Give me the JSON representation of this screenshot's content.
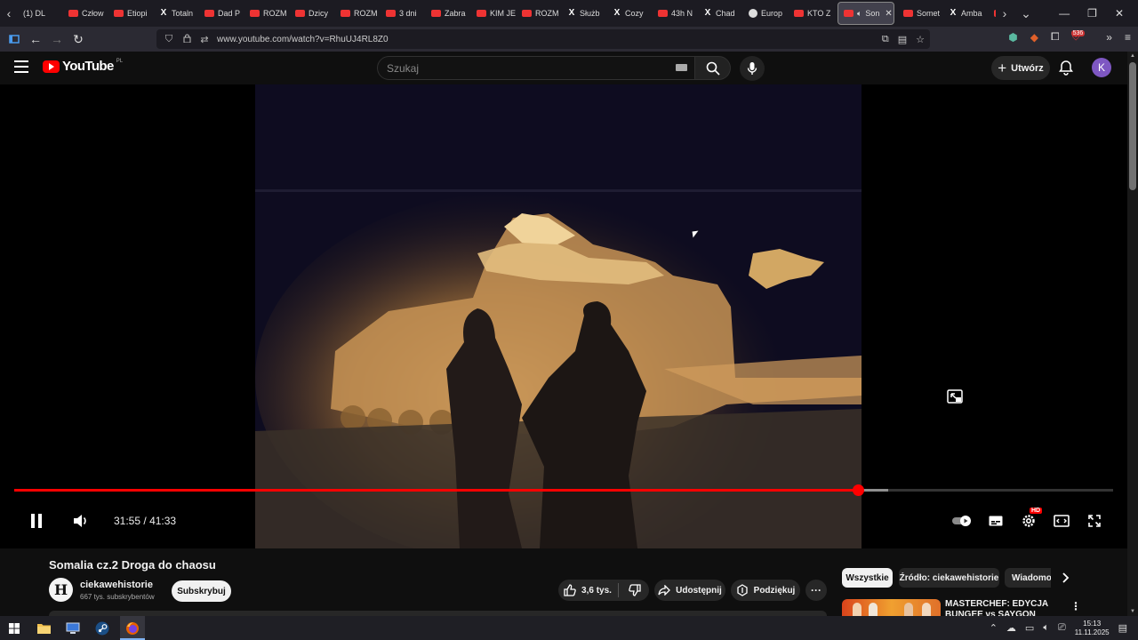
{
  "browser": {
    "tabs": [
      {
        "label": "(1) DL",
        "favicon": "none"
      },
      {
        "label": "Człow",
        "favicon": "youtube"
      },
      {
        "label": "Etiopi",
        "favicon": "youtube"
      },
      {
        "label": "Totaln",
        "favicon": "x"
      },
      {
        "label": "Dad P",
        "favicon": "youtube"
      },
      {
        "label": "ROZM",
        "favicon": "youtube"
      },
      {
        "label": "Dzicy",
        "favicon": "youtube"
      },
      {
        "label": "ROZM",
        "favicon": "youtube"
      },
      {
        "label": "3 dni",
        "favicon": "youtube"
      },
      {
        "label": "Zabra",
        "favicon": "youtube"
      },
      {
        "label": "KIM JE",
        "favicon": "youtube"
      },
      {
        "label": "ROZM",
        "favicon": "youtube"
      },
      {
        "label": "Służb",
        "favicon": "x"
      },
      {
        "label": "Cozy",
        "favicon": "x"
      },
      {
        "label": "43h N",
        "favicon": "youtube"
      },
      {
        "label": "Chad",
        "favicon": "x"
      },
      {
        "label": "Europ",
        "favicon": "globe"
      },
      {
        "label": "KTO Z",
        "favicon": "youtube"
      },
      {
        "label": "Son",
        "favicon": "youtube",
        "active": true,
        "audio": true
      },
      {
        "label": "Somet",
        "favicon": "youtube"
      },
      {
        "label": "Amba",
        "favicon": "x"
      },
      {
        "label": "nasz",
        "favicon": "youtube"
      }
    ],
    "url": "www.youtube.com/watch?v=RhuUJ4RL8Z0",
    "extension_badge": "536"
  },
  "youtube": {
    "logo_text": "YouTube",
    "region": "PL",
    "search_placeholder": "Szukaj",
    "create_label": "Utwórz",
    "avatar_letter": "K"
  },
  "player": {
    "current_time": "31:55",
    "duration": "41:33",
    "time_separator": "/",
    "progress": 0.768,
    "buffered": 0.795,
    "quality_badge": "HD",
    "state": "playing",
    "colors": {
      "accent": "#ff0000"
    }
  },
  "video": {
    "title": "Somalia cz.2 Droga do chaosu",
    "channel_initial": "H",
    "channel_name": "ciekawehistorie",
    "subscribers": "667 tys. subskrybentów",
    "subscribe_label": "Subskrybuj",
    "likes": "3,6 tys.",
    "share_label": "Udostępnij",
    "thanks_label": "Podziękuj"
  },
  "sidebar": {
    "chips": [
      "Wszystkie",
      "Źródło: ciekawehistorie",
      "Wiadomo"
    ],
    "recommendation": {
      "title": "MASTERCHEF: EDYCJA BUNGEE vs SAYGON"
    }
  },
  "taskbar": {
    "time": "15:13",
    "date": "11.11.2025"
  }
}
